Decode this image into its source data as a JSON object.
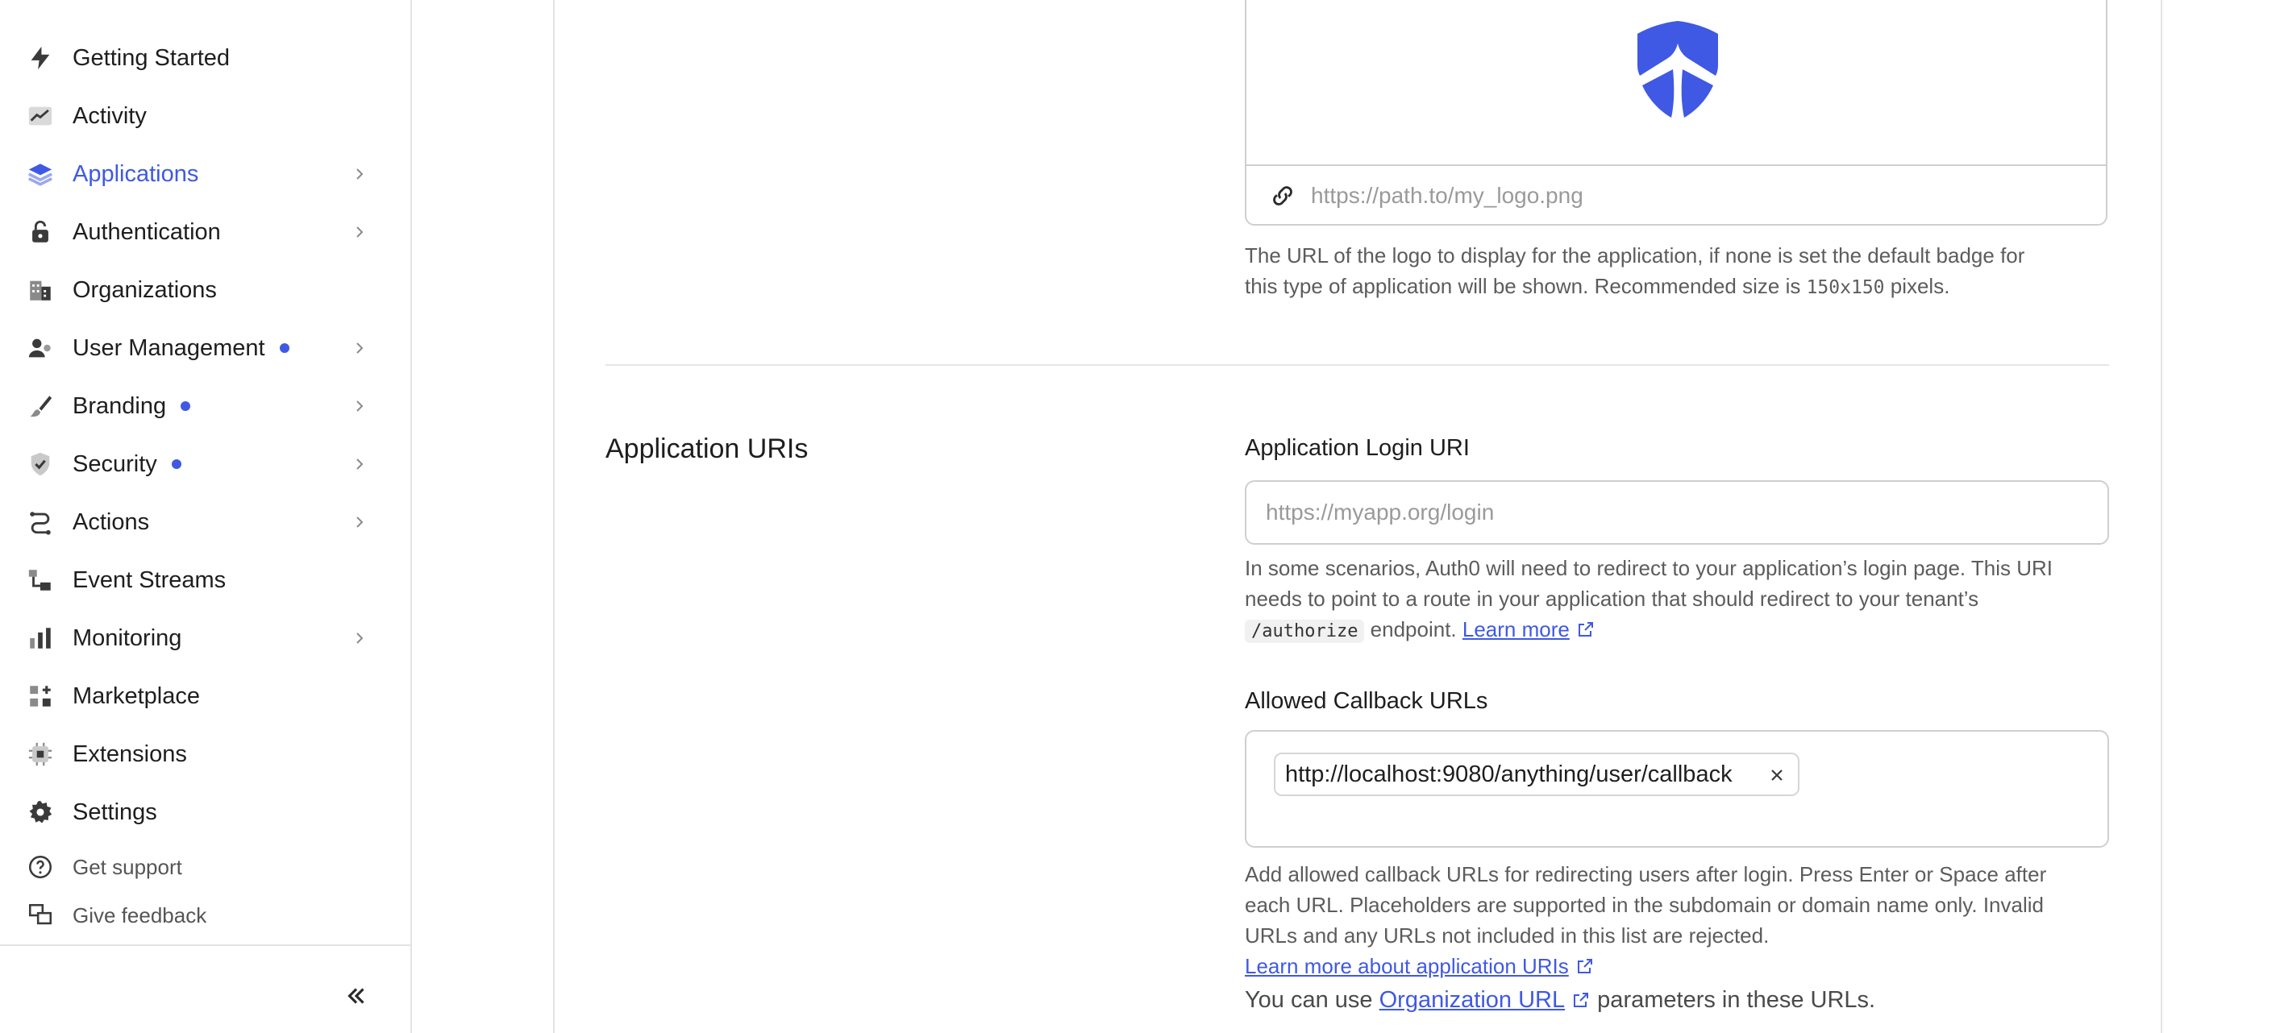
{
  "sidebar": {
    "items": [
      {
        "label": "Getting Started",
        "icon": "lightning-icon",
        "chevron": false,
        "dot": false,
        "active": false
      },
      {
        "label": "Activity",
        "icon": "activity-chart-icon",
        "chevron": false,
        "dot": false,
        "active": false
      },
      {
        "label": "Applications",
        "icon": "layers-icon",
        "chevron": true,
        "dot": false,
        "active": true
      },
      {
        "label": "Authentication",
        "icon": "lock-icon",
        "chevron": true,
        "dot": false,
        "active": false
      },
      {
        "label": "Organizations",
        "icon": "building-icon",
        "chevron": false,
        "dot": false,
        "active": false
      },
      {
        "label": "User Management",
        "icon": "users-icon",
        "chevron": true,
        "dot": true,
        "active": false
      },
      {
        "label": "Branding",
        "icon": "brush-icon",
        "chevron": true,
        "dot": true,
        "active": false
      },
      {
        "label": "Security",
        "icon": "shield-check-icon",
        "chevron": true,
        "dot": true,
        "active": false
      },
      {
        "label": "Actions",
        "icon": "flow-icon",
        "chevron": true,
        "dot": false,
        "active": false
      },
      {
        "label": "Event Streams",
        "icon": "event-streams-icon",
        "chevron": false,
        "dot": false,
        "active": false
      },
      {
        "label": "Monitoring",
        "icon": "bar-chart-icon",
        "chevron": true,
        "dot": false,
        "active": false
      },
      {
        "label": "Marketplace",
        "icon": "marketplace-icon",
        "chevron": false,
        "dot": false,
        "active": false
      },
      {
        "label": "Extensions",
        "icon": "chip-icon",
        "chevron": false,
        "dot": false,
        "active": false
      },
      {
        "label": "Settings",
        "icon": "gear-icon",
        "chevron": false,
        "dot": false,
        "active": false
      }
    ],
    "footer": [
      {
        "label": "Get support",
        "icon": "help-circle-icon"
      },
      {
        "label": "Give feedback",
        "icon": "feedback-icon"
      }
    ],
    "collapse_icon": "double-chevron-left-icon"
  },
  "colors": {
    "accent": "#3f59e4",
    "border": "#cfcfcf",
    "muted_text": "#5c5c5c"
  },
  "logo_field": {
    "placeholder": "https://path.to/my_logo.png",
    "help_line1": "The URL of the logo to display for the application, if none is set the default badge for",
    "help_line2_pre": "this type of application will be shown. Recommended size is ",
    "help_size": "150x150",
    "help_line2_post": " pixels."
  },
  "application_uris": {
    "section_title": "Application URIs",
    "login_uri": {
      "label": "Application Login URI",
      "placeholder": "https://myapp.org/login",
      "help_line1": "In some scenarios, Auth0 will need to redirect to your application’s login page. This URI",
      "help_line2": "needs to point to a route in your application that should redirect to your tenant’s",
      "help_code": "/authorize",
      "help_line3_post": " endpoint. ",
      "learn_more": "Learn more"
    },
    "callback_urls": {
      "label": "Allowed Callback URLs",
      "tags": [
        "http://localhost:9080/anything/user/callback"
      ],
      "help_line1": "Add allowed callback URLs for redirecting users after login. Press Enter or Space after",
      "help_line2": "each URL. Placeholders are supported in the subdomain or domain name only. Invalid",
      "help_line3": "URLs and any URLs not included in this list are rejected.",
      "learn_more": "Learn more about application URIs",
      "org_pre": "You can use ",
      "org_link": "Organization URL",
      "org_post": " parameters in these URLs."
    }
  }
}
